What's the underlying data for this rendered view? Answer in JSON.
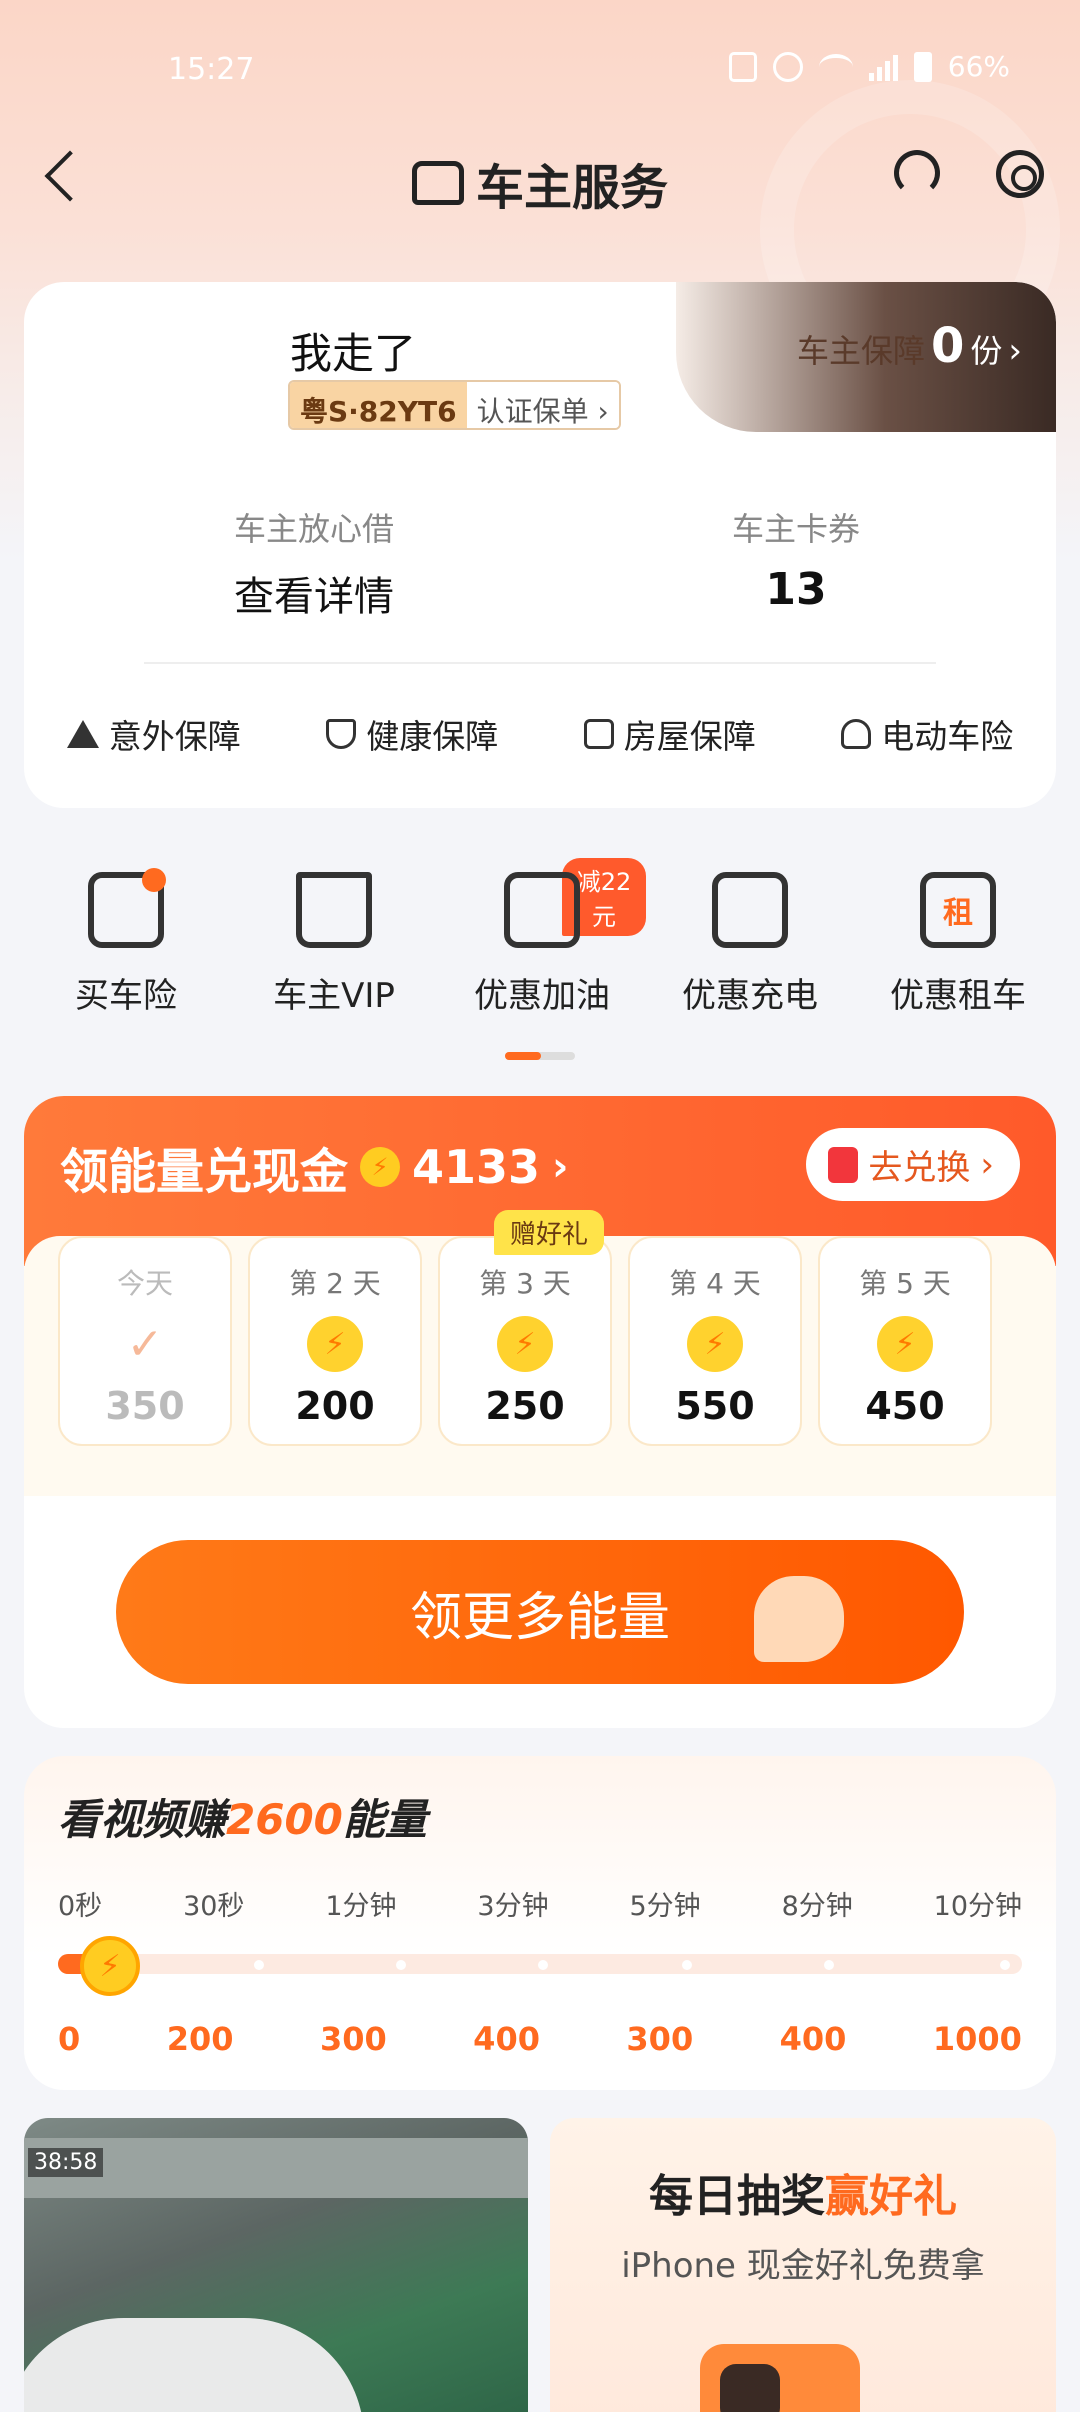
{
  "status_bar": {
    "time": "15:27",
    "battery": "66%"
  },
  "header": {
    "title": "车主服务"
  },
  "profile": {
    "username": "我走了",
    "plate": "粤S·82YT6",
    "cert_label": "认证保单",
    "guard_label": "车主保障",
    "guard_count": "0",
    "guard_unit": "份",
    "stats": [
      {
        "label": "车主放心借",
        "value": "查看详情"
      },
      {
        "label": "车主卡券",
        "value": "13"
      }
    ],
    "insurance": [
      {
        "label": "意外保障",
        "icon": "warning-icon"
      },
      {
        "label": "健康保障",
        "icon": "shield-check-icon"
      },
      {
        "label": "房屋保障",
        "icon": "house-icon"
      },
      {
        "label": "电动车险",
        "icon": "ebike-icon"
      }
    ]
  },
  "services": [
    {
      "label": "买车险",
      "icon": "car-insurance-icon"
    },
    {
      "label": "车主VIP",
      "icon": "crown-icon"
    },
    {
      "label": "优惠加油",
      "icon": "fuel-icon",
      "badge": "减22元"
    },
    {
      "label": "优惠充电",
      "icon": "charging-icon"
    },
    {
      "label": "优惠租车",
      "icon": "rent-car-icon",
      "icon_text": "租"
    }
  ],
  "energy": {
    "title": "领能量兑现金",
    "points": "4133",
    "exchange_label": "去兑换",
    "gift_label": "赠好礼",
    "days": [
      {
        "label": "今天",
        "value": "350",
        "done": true
      },
      {
        "label": "第 2 天",
        "value": "200"
      },
      {
        "label": "第 3 天",
        "value": "250"
      },
      {
        "label": "第 4 天",
        "value": "550"
      },
      {
        "label": "第 5 天",
        "value": "450"
      }
    ],
    "button_label": "领更多能量"
  },
  "video": {
    "title_prefix": "看视频赚",
    "title_amount": "2600",
    "title_suffix": "能量",
    "timeline": [
      {
        "time": "0秒",
        "value": "0"
      },
      {
        "time": "30秒",
        "value": "200"
      },
      {
        "time": "1分钟",
        "value": "300"
      },
      {
        "time": "3分钟",
        "value": "400"
      },
      {
        "time": "5分钟",
        "value": "300"
      },
      {
        "time": "8分钟",
        "value": "400"
      },
      {
        "time": "10分钟",
        "value": "1000"
      }
    ]
  },
  "cards": {
    "photo_timestamp": "38:58",
    "lottery_title_a": "每日抽奖",
    "lottery_title_b": "赢好礼",
    "lottery_subtitle": "iPhone 现金好礼免费拿"
  },
  "colors": {
    "accent": "#ff6a1f",
    "energy_head": "#ff5a2a",
    "guard_dark": "#3a2a24"
  }
}
